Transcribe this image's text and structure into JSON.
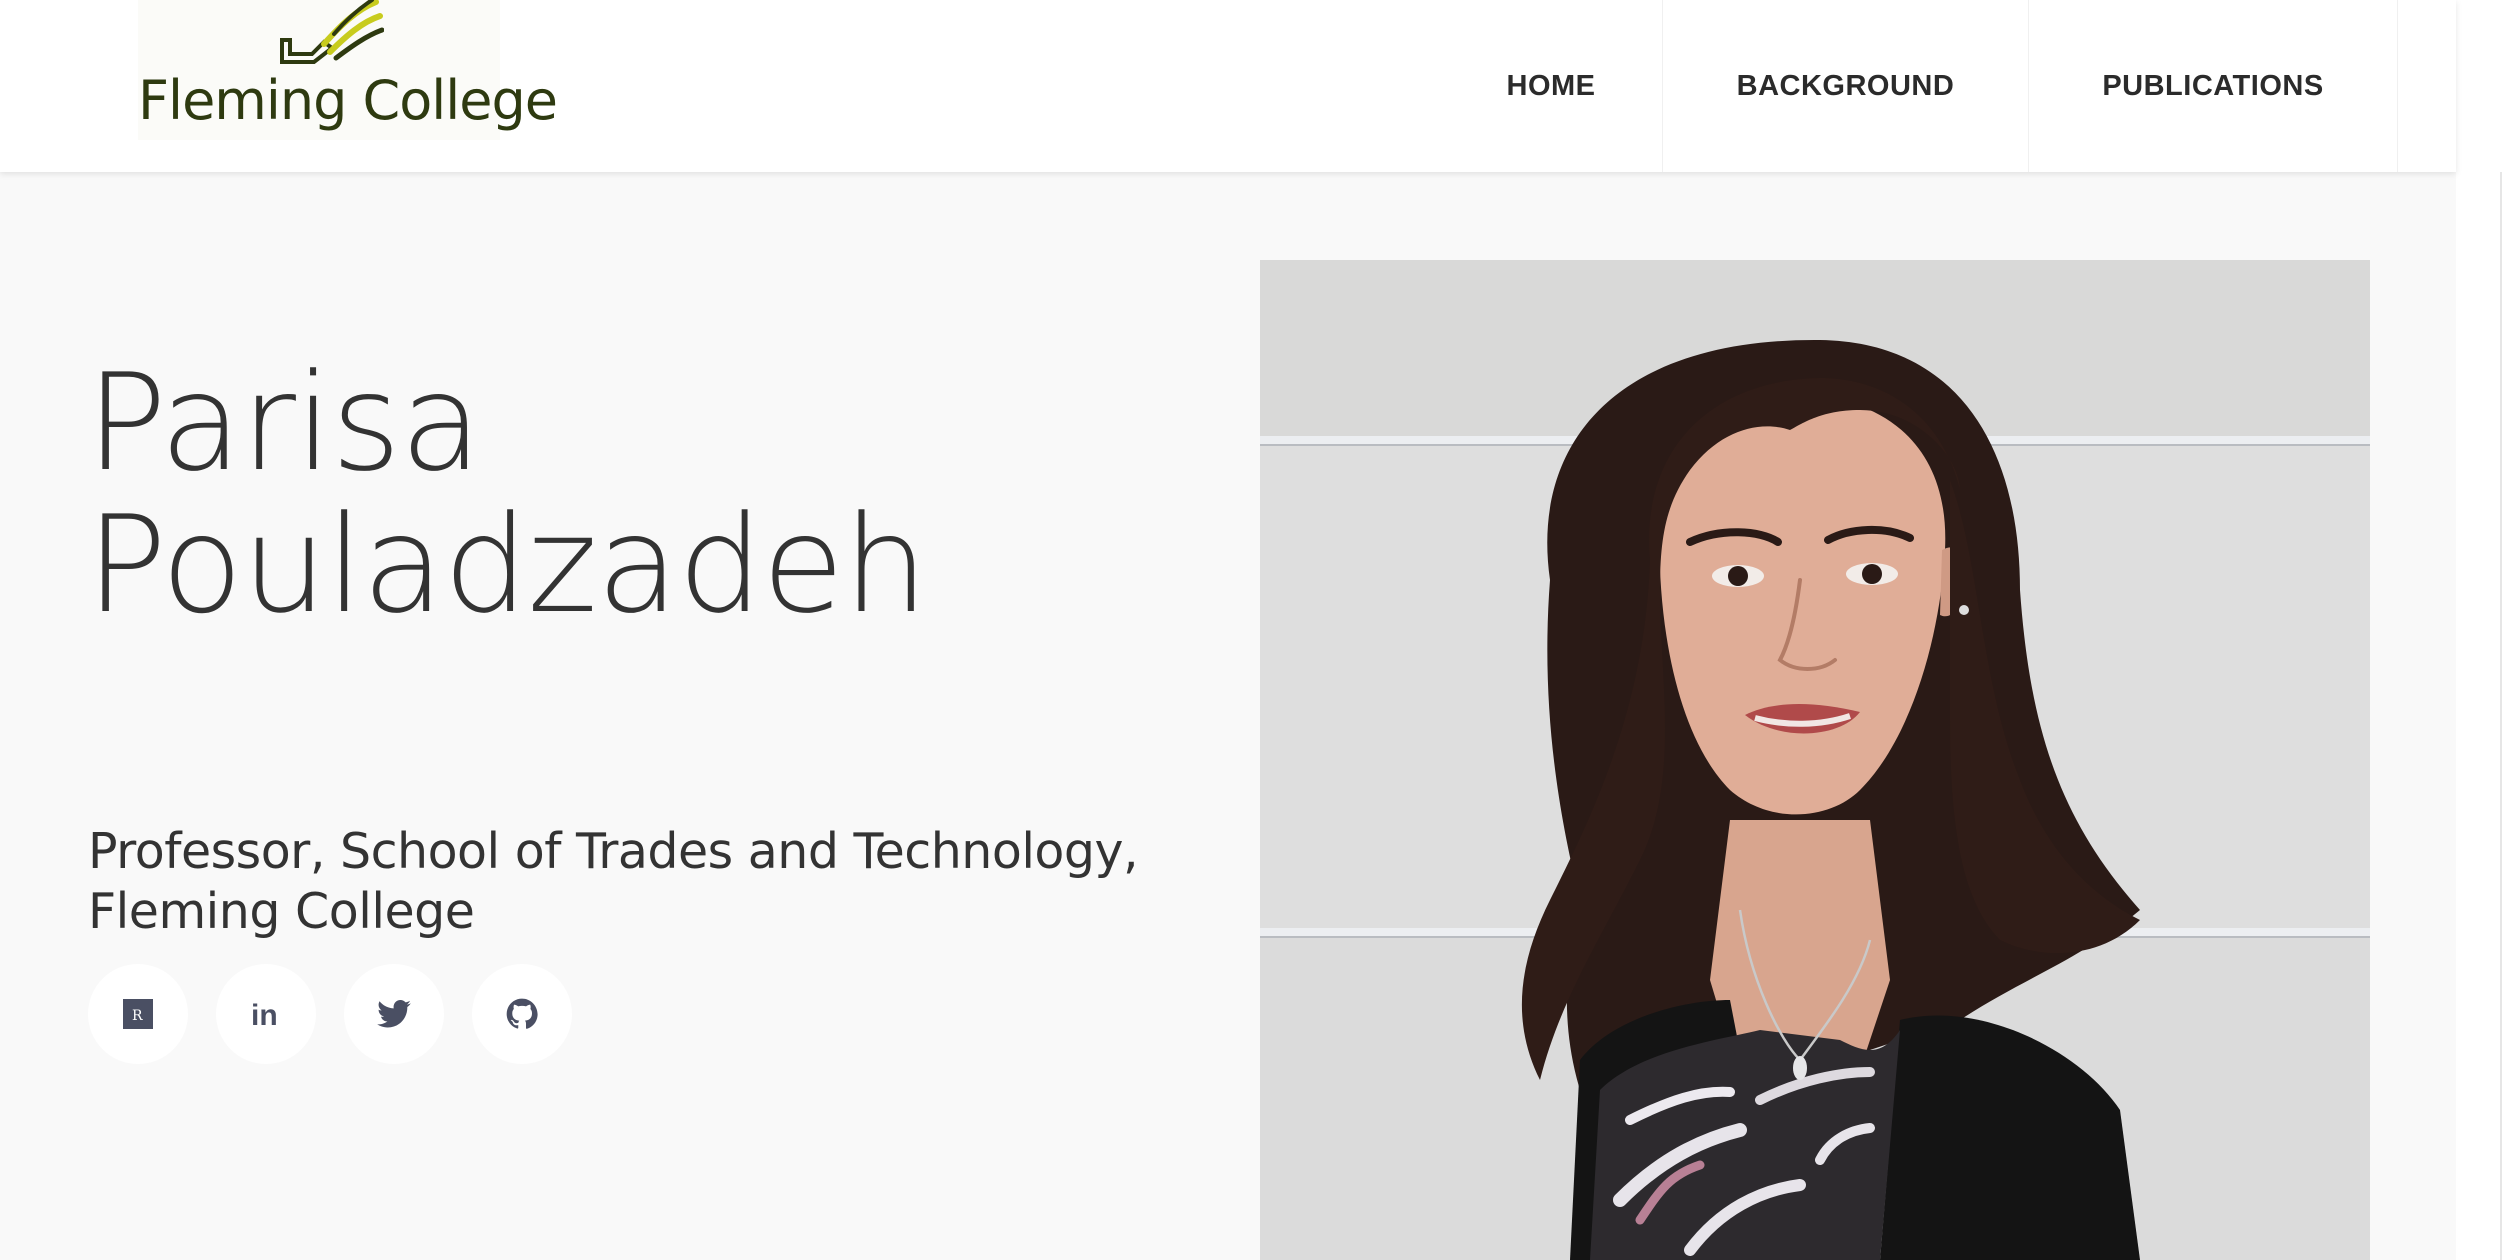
{
  "header": {
    "logo_text": "Fleming College",
    "nav": [
      {
        "label": "HOME"
      },
      {
        "label": "BACKGROUND"
      },
      {
        "label": "PUBLICATIONS"
      }
    ]
  },
  "hero": {
    "name_first": "Parisa",
    "name_last": "Pouladzadeh",
    "subtitle_line1": "Professor, School of Trades and Technology,",
    "subtitle_line2": "Fleming College",
    "social_links": [
      {
        "icon": "researchgate-icon",
        "glyph": "R"
      },
      {
        "icon": "linkedin-icon",
        "glyph": "in"
      },
      {
        "icon": "twitter-icon"
      },
      {
        "icon": "github-icon"
      }
    ]
  },
  "colors": {
    "logo_text": "#2e3a10",
    "logo_accent": "#c8cc1e",
    "nav_text": "#2b2b2b",
    "hero_background": "#f9f9f9",
    "heading_text": "#333333",
    "icon_color": "#4a4f63"
  }
}
